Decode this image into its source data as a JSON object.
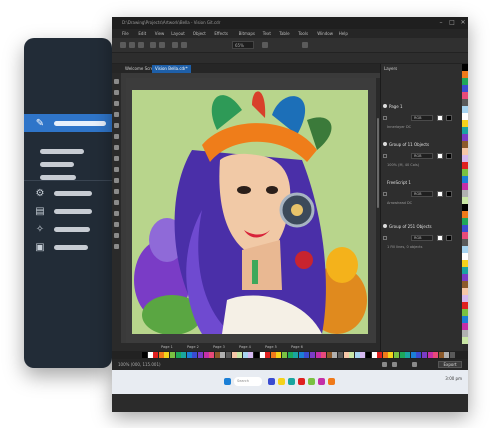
{
  "sidebar": {
    "items": [
      {
        "name": "pin",
        "icon": "pin-icon",
        "active": true
      },
      {
        "name": "item-2",
        "icon": "",
        "active": false
      },
      {
        "name": "item-3",
        "icon": "",
        "active": false
      },
      {
        "name": "item-4",
        "icon": "",
        "active": false
      },
      {
        "name": "item-5",
        "icon": "settings-icon",
        "active": false
      },
      {
        "name": "item-6",
        "icon": "document-icon",
        "active": false
      },
      {
        "name": "item-7",
        "icon": "wrench-icon",
        "active": false
      },
      {
        "name": "item-8",
        "icon": "image-icon",
        "active": false
      }
    ]
  },
  "window": {
    "title": "D:\\Drawing\\Projects\\Artwork\\Bella - Vision Git.cdr",
    "menu": [
      "File",
      "Edit",
      "View",
      "Layout",
      "Object",
      "Effects",
      "Bitmaps",
      "Text",
      "Table",
      "Tools",
      "Window",
      "Help"
    ],
    "tabs": [
      {
        "label": "Welcome Screen",
        "active": false
      },
      {
        "label": "Vision Bella.cdr*",
        "active": true
      }
    ],
    "zoom": "65%",
    "pages": [
      "Page 1",
      "Page 2",
      "Page 3",
      "Page 4",
      "Page 5",
      "Page 6"
    ],
    "status_left": "100%  (000, 115.001)",
    "status_right": "Export",
    "search_placeholder": "Search",
    "clock": "3:00 pm"
  },
  "docker": {
    "title": "Layers",
    "groups": [
      {
        "head": "Page 1",
        "mode": "RGB",
        "sub": "Innerlayer DC"
      },
      {
        "head": "Group of 11 Objects",
        "mode": "RGB",
        "sub": "100% (M, 40 Cols)"
      },
      {
        "head": "FreeScript 1",
        "mode": "RGB",
        "sub": "Arrowhead DC"
      },
      {
        "head": "Group of 251 Objects",
        "mode": "RGB",
        "sub": "1 Fill lines, 0 objects"
      }
    ]
  },
  "colors": {
    "accent": "#2f75c9",
    "artboard": "#b8d58c",
    "palette": [
      "#000000",
      "#ffffff",
      "#e02020",
      "#f07a1a",
      "#f4d21b",
      "#7ac142",
      "#1ea85a",
      "#1aa5a0",
      "#1b7fd6",
      "#3a4bd1",
      "#7a3cc6",
      "#c42fa8",
      "#e84a7a",
      "#8c5a2b",
      "#b0b0b0",
      "#5a5a5a",
      "#f6c7a8",
      "#c9e6a5",
      "#a7d4f0",
      "#d5b9f0"
    ]
  }
}
